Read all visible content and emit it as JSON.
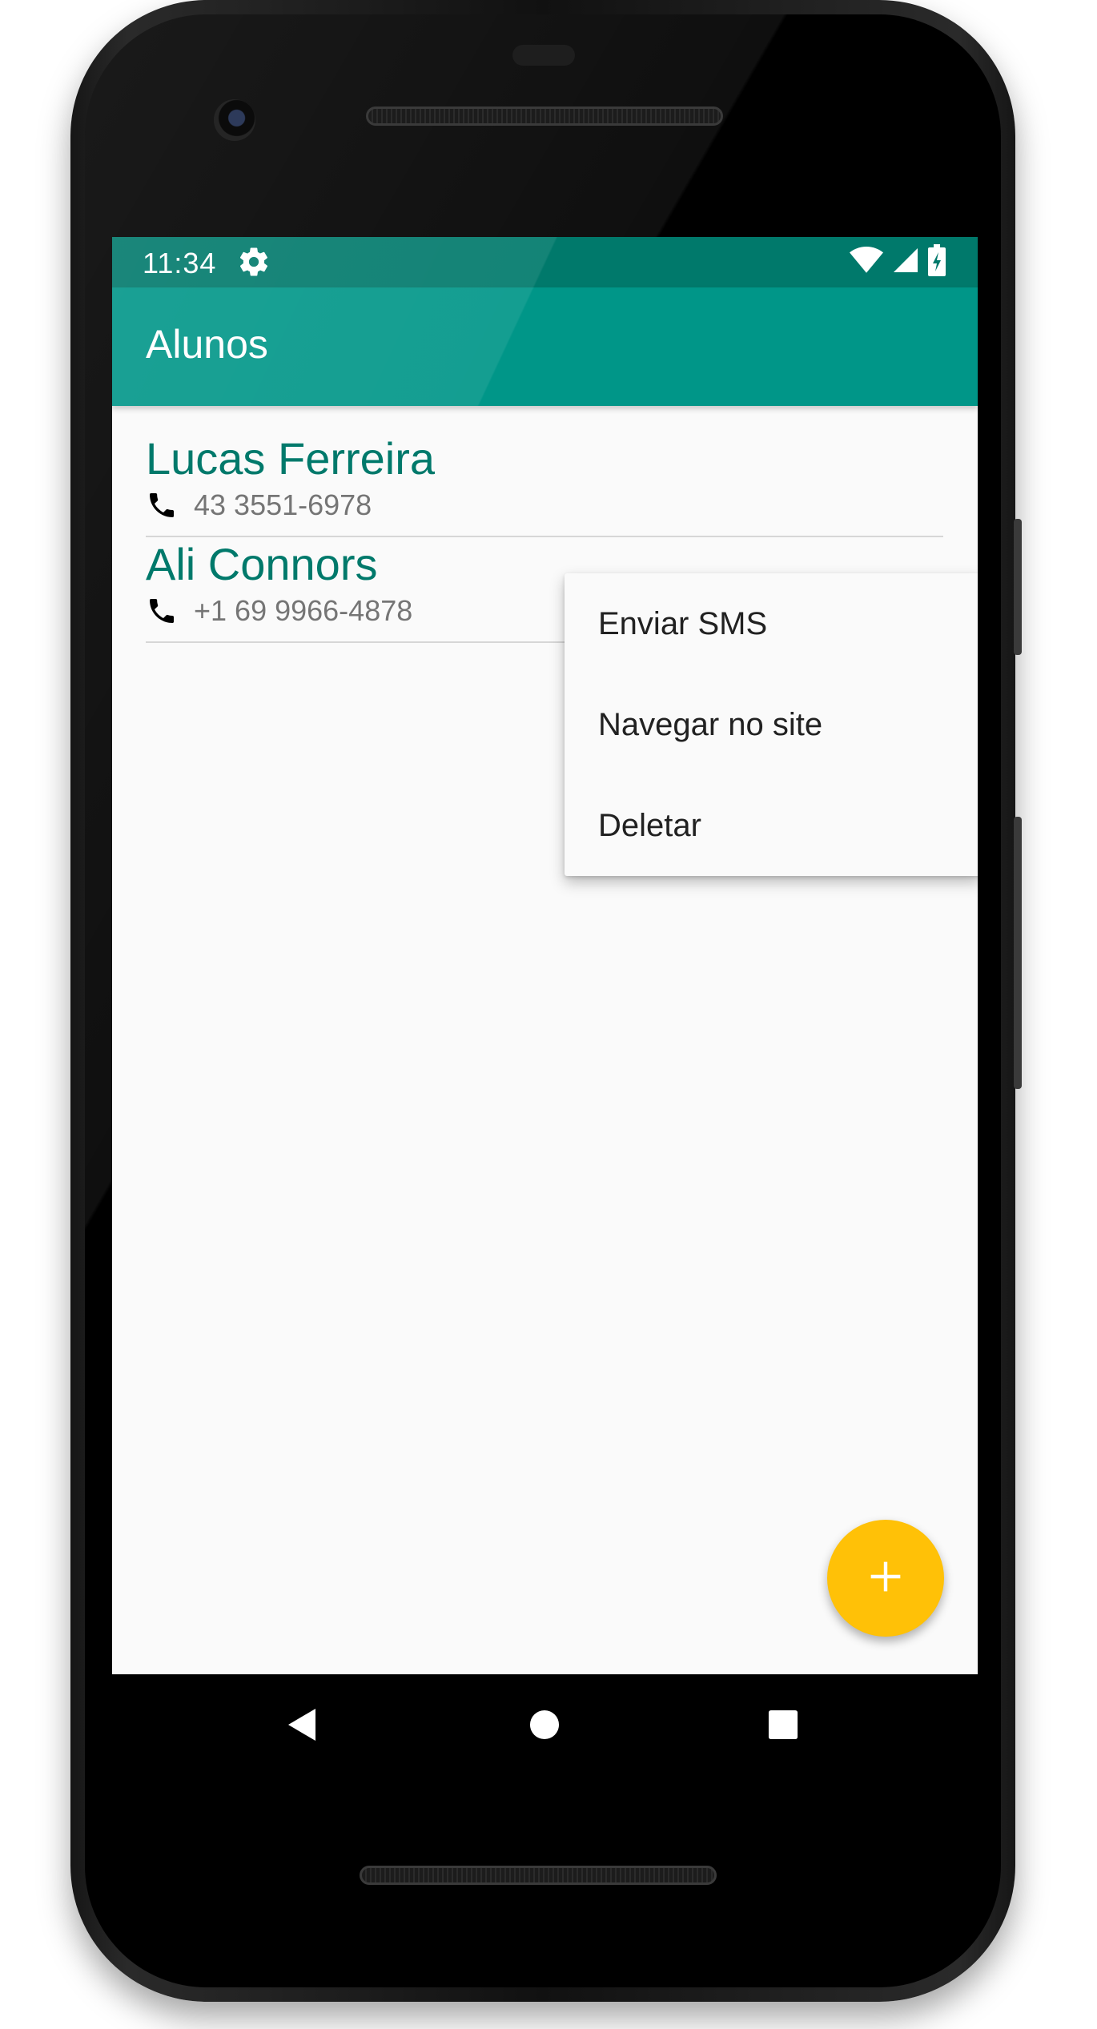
{
  "status_bar": {
    "time": "11:34",
    "icons": [
      "settings-icon",
      "wifi-icon",
      "cell-signal-icon",
      "battery-charging-icon"
    ]
  },
  "app_bar": {
    "title": "Alunos"
  },
  "students": [
    {
      "name": "Lucas Ferreira",
      "phone": "43 3551-6978",
      "icon": "phone-icon"
    },
    {
      "name": "Ali Connors",
      "phone": "+1 69 9966-4878",
      "icon": "phone-icon"
    }
  ],
  "context_menu": {
    "items": [
      {
        "label": "Enviar SMS"
      },
      {
        "label": "Navegar no site"
      },
      {
        "label": "Deletar"
      }
    ]
  },
  "fab": {
    "icon": "add-icon"
  },
  "nav_bar": {
    "icons": [
      "back-icon",
      "home-icon",
      "recents-icon"
    ]
  },
  "colors": {
    "primary": "#009688",
    "primary_dark": "#00796b",
    "accent": "#ffc107",
    "background": "#fafafa",
    "secondary_text": "#757575"
  }
}
